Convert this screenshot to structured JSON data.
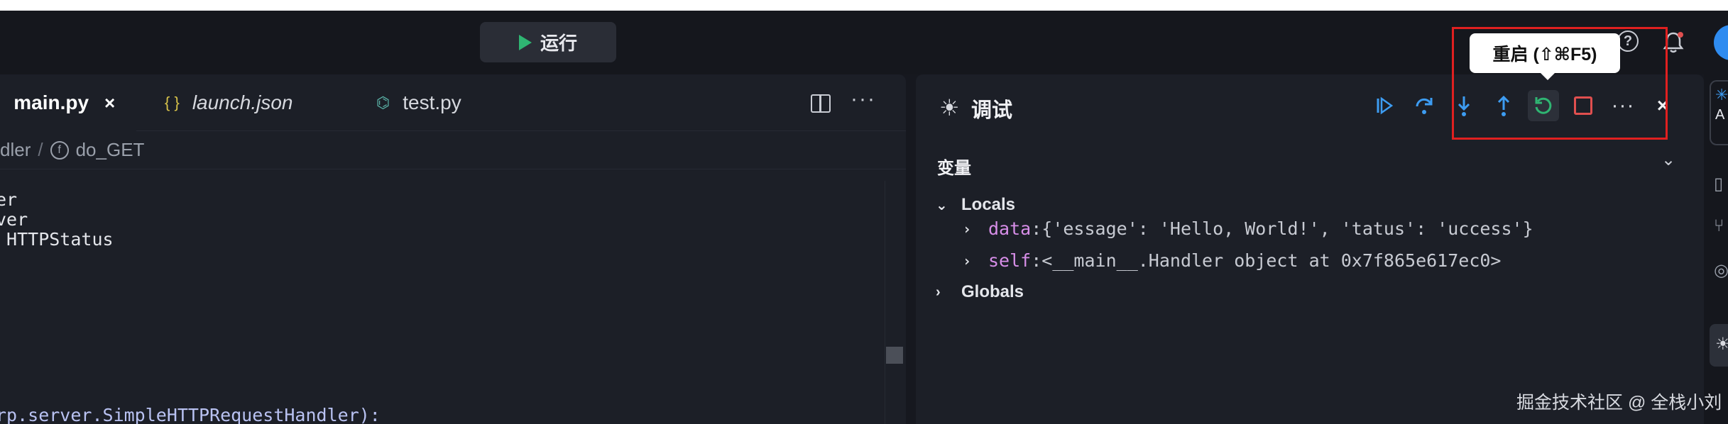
{
  "titlebar": {
    "run_label": "运行",
    "help_icon": "?"
  },
  "editor": {
    "tabs": [
      {
        "label": "main.py",
        "icon": "python-icon",
        "active": true,
        "close": "×"
      },
      {
        "label": "launch.json",
        "icon": "json-icon",
        "icon_glyph": "{ }"
      },
      {
        "label": "test.py",
        "icon": "python-icon"
      }
    ],
    "more": "···",
    "breadcrumb": {
      "class_part": "dler",
      "separator": "/",
      "fn_icon": "f",
      "fn_name": "do_GET"
    },
    "code_lines": [
      "er",
      "ver",
      " HTTPStatus",
      "rp.server.SimpleHTTPRequestHandler):"
    ]
  },
  "debug": {
    "title": "调试",
    "tooltip": "重启 (⇧⌘F5)",
    "variables_header": "变量",
    "locals_label": "Locals",
    "globals_label": "Globals",
    "vars": [
      {
        "name": "data",
        "value": "{'essage': 'Hello, World!', 'tatus': 'uccess'}"
      },
      {
        "name": "self",
        "value": "<__main__.Handler object at 0x7f865e617ec0>"
      }
    ],
    "more": "···",
    "close": "×"
  },
  "watermark": "掘金技术社区 @ 全栈小刘",
  "activity": {
    "ai_label": "A"
  },
  "colors": {
    "run_green": "#2fb572",
    "step_blue": "#3d9cf2",
    "stop_red": "#e04f4f",
    "var_name": "#d78ee8",
    "highlight_box": "#e02020"
  }
}
